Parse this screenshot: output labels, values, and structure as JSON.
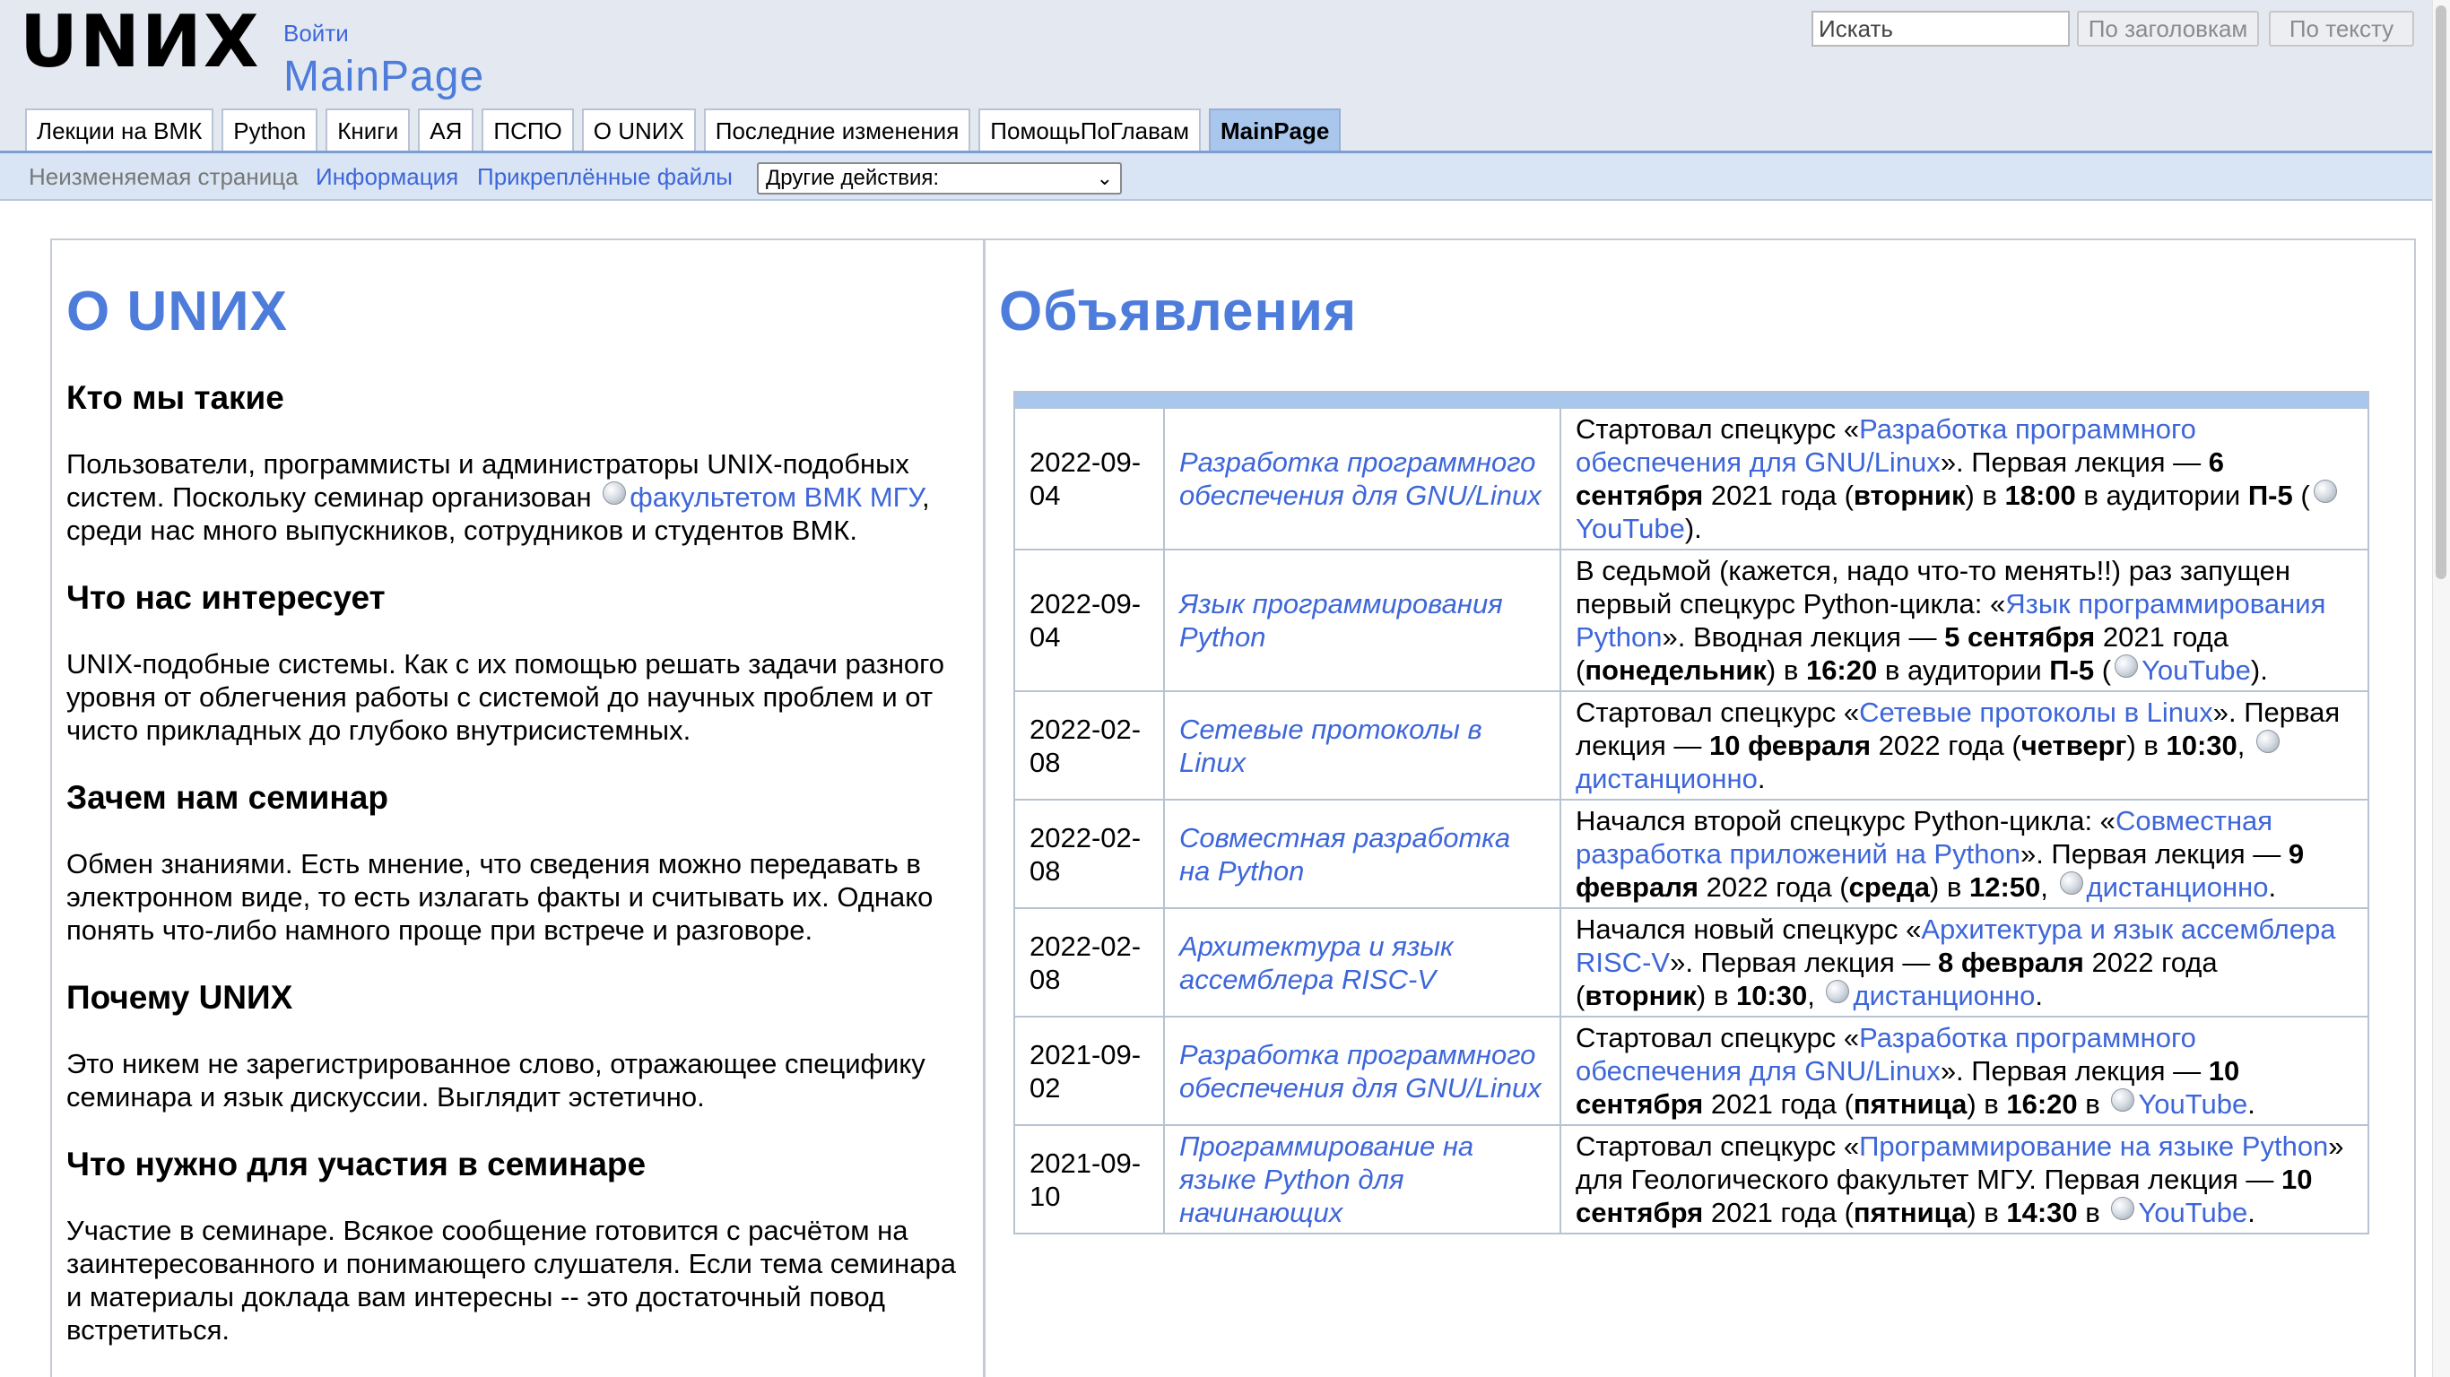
{
  "header": {
    "logo": "UNИX",
    "login_link": "Войти",
    "page_name": "MainPage",
    "search": {
      "placeholder": "Искать",
      "titles_button": "По заголовкам",
      "text_button": "По тексту"
    }
  },
  "tabs": [
    {
      "label": "Лекции на ВМК",
      "active": false
    },
    {
      "label": "Python",
      "active": false
    },
    {
      "label": "Книги",
      "active": false
    },
    {
      "label": "АЯ",
      "active": false
    },
    {
      "label": "ПСПО",
      "active": false
    },
    {
      "label": "О UNИX",
      "active": false
    },
    {
      "label": "Последние изменения",
      "active": false
    },
    {
      "label": "ПомощьПоГлавам",
      "active": false
    },
    {
      "label": "MainPage",
      "active": true
    }
  ],
  "subnav": {
    "protected": "Неизменяемая страница",
    "info": "Информация",
    "files": "Прикреплённые файлы",
    "other_actions": "Другие действия:"
  },
  "left": {
    "title": "О UNИX",
    "sections": [
      {
        "heading": "Кто мы такие",
        "parts": [
          {
            "t": "Пользователи, программисты и администраторы UNIX-подобных систем. Поскольку семинар организован "
          },
          {
            "icon": "globe-icon"
          },
          {
            "t": "факультетом ВМК МГУ",
            "link": true
          },
          {
            "t": ", среди нас много выпускников, сотрудников и студентов ВМК."
          }
        ]
      },
      {
        "heading": "Что нас интересует",
        "parts": [
          {
            "t": "UNIX-подобные системы. Как с их помощью решать задачи разного уровня от облегчения работы с системой до научных проблем и от чисто прикладных до глубоко внутрисистемных."
          }
        ]
      },
      {
        "heading": "Зачем нам семинар",
        "parts": [
          {
            "t": "Обмен знаниями. Есть мнение, что сведения можно передавать в электронном виде, то есть излагать факты и считывать их. Однако понять что-либо намного проще при встрече и разговоре."
          }
        ]
      },
      {
        "heading": "Почему UNИX",
        "parts": [
          {
            "t": "Это никем не зарегистрированное слово, отражающее специфику семинара и язык дискуссии. Выглядит эстетично."
          }
        ]
      },
      {
        "heading": "Что нужно для участия в семинаре",
        "parts": [
          {
            "t": "Участие в семинаре. Всякое сообщение готовится с расчётом на заинтересованного и понимающего слушателя. Если тема семинара и материалы доклада вам интересны -- это достаточный повод встретиться."
          }
        ]
      }
    ]
  },
  "right": {
    "title": "Объявления",
    "news": [
      {
        "date": "2022-09-04",
        "course": "Разработка программного обеспечения для GNU/Linux",
        "parts": [
          {
            "t": "Стартовал спецкурс «"
          },
          {
            "t": "Разработка программного обеспечения для GNU/Linux",
            "link": true
          },
          {
            "t": "». Первая лекция — "
          },
          {
            "t": "6 сентября",
            "b": true
          },
          {
            "t": " 2021 года ("
          },
          {
            "t": "вторник",
            "b": true
          },
          {
            "t": ") в "
          },
          {
            "t": "18:00",
            "b": true
          },
          {
            "t": " в аудитории "
          },
          {
            "t": "П-5",
            "b": true
          },
          {
            "t": " ("
          },
          {
            "icon": "globe-icon"
          },
          {
            "t": "YouTube",
            "link": true
          },
          {
            "t": ")."
          }
        ]
      },
      {
        "date": "2022-09-04",
        "course": "Язык программирования Python",
        "parts": [
          {
            "t": "В седьмой (кажется, надо что-то менять!!) раз запущен первый спецкурс Python-цикла: «"
          },
          {
            "t": "Язык программирования Python",
            "link": true
          },
          {
            "t": "». Вводная лекция — "
          },
          {
            "t": "5 сентября",
            "b": true
          },
          {
            "t": " 2021 года ("
          },
          {
            "t": "понедельник",
            "b": true
          },
          {
            "t": ") в "
          },
          {
            "t": "16:20",
            "b": true
          },
          {
            "t": " в аудитории "
          },
          {
            "t": "П-5",
            "b": true
          },
          {
            "t": " ("
          },
          {
            "icon": "globe-icon"
          },
          {
            "t": "YouTube",
            "link": true
          },
          {
            "t": ")."
          }
        ]
      },
      {
        "date": "2022-02-08",
        "course": "Сетевые протоколы в Linux",
        "parts": [
          {
            "t": "Стартовал спецкурс «"
          },
          {
            "t": "Сетевые протоколы в Linux",
            "link": true
          },
          {
            "t": "». Первая лекция — "
          },
          {
            "t": "10 февраля",
            "b": true
          },
          {
            "t": " 2022 года ("
          },
          {
            "t": "четверг",
            "b": true
          },
          {
            "t": ") в "
          },
          {
            "t": "10:30",
            "b": true
          },
          {
            "t": ", "
          },
          {
            "icon": "globe-icon"
          },
          {
            "t": "дистанционно",
            "link": true
          },
          {
            "t": "."
          }
        ]
      },
      {
        "date": "2022-02-08",
        "course": "Совместная разработка на Python",
        "parts": [
          {
            "t": "Начался второй спецкурс Python-цикла: «"
          },
          {
            "t": "Совместная разработка приложений на Python",
            "link": true
          },
          {
            "t": "». Первая лекция — "
          },
          {
            "t": "9 февраля",
            "b": true
          },
          {
            "t": " 2022 года ("
          },
          {
            "t": "среда",
            "b": true
          },
          {
            "t": ") в "
          },
          {
            "t": "12:50",
            "b": true
          },
          {
            "t": ", "
          },
          {
            "icon": "globe-icon"
          },
          {
            "t": "дистанционно",
            "link": true
          },
          {
            "t": "."
          }
        ]
      },
      {
        "date": "2022-02-08",
        "course": "Архитектура и язык ассемблера RISC-V",
        "parts": [
          {
            "t": "Начался новый спецкурс «"
          },
          {
            "t": "Архитектура и язык ассемблера RISC-V",
            "link": true
          },
          {
            "t": "». Первая лекция — "
          },
          {
            "t": "8 февраля",
            "b": true
          },
          {
            "t": " 2022 года ("
          },
          {
            "t": "вторник",
            "b": true
          },
          {
            "t": ") в "
          },
          {
            "t": "10:30",
            "b": true
          },
          {
            "t": ", "
          },
          {
            "icon": "globe-icon"
          },
          {
            "t": "дистанционно",
            "link": true
          },
          {
            "t": "."
          }
        ]
      },
      {
        "date": "2021-09-02",
        "course": "Разработка программного обеспечения для GNU/Linux",
        "parts": [
          {
            "t": "Стартовал спецкурс «"
          },
          {
            "t": "Разработка программного обеспечения для GNU/Linux",
            "link": true
          },
          {
            "t": "». Первая лекция — "
          },
          {
            "t": "10 сентября",
            "b": true
          },
          {
            "t": " 2021 года ("
          },
          {
            "t": "пятница",
            "b": true
          },
          {
            "t": ") в "
          },
          {
            "t": "16:20",
            "b": true
          },
          {
            "t": " в "
          },
          {
            "icon": "globe-icon"
          },
          {
            "t": "YouTube",
            "link": true
          },
          {
            "t": "."
          }
        ]
      },
      {
        "date": "2021-09-10",
        "course": "Программирование на языке Python для начинающих",
        "parts": [
          {
            "t": "Стартовал спецкурс «"
          },
          {
            "t": "Программирование на языке Python",
            "link": true
          },
          {
            "t": "» для Геологического факультет МГУ. Первая лекция — "
          },
          {
            "t": "10 сентября",
            "b": true
          },
          {
            "t": " 2021 года ("
          },
          {
            "t": "пятница",
            "b": true
          },
          {
            "t": ") в "
          },
          {
            "t": "14:30",
            "b": true
          },
          {
            "t": " в "
          },
          {
            "icon": "globe-icon"
          },
          {
            "t": "YouTube",
            "link": true
          },
          {
            "t": "."
          }
        ]
      }
    ]
  }
}
